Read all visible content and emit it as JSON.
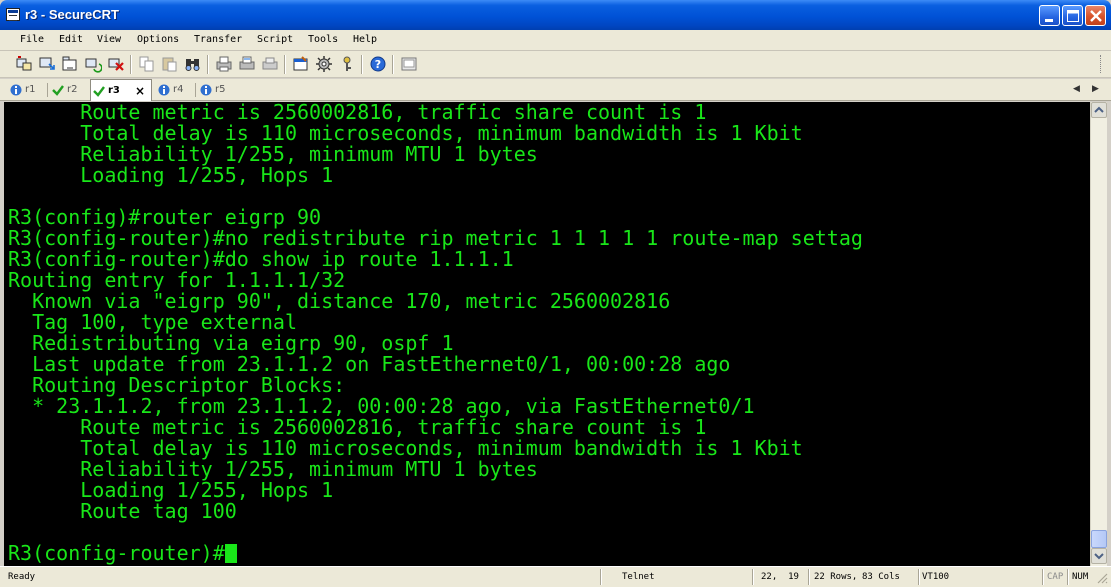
{
  "window": {
    "title": "r3 - SecureCRT",
    "icon": "securecrt-app-icon",
    "controls": [
      "minimize-icon",
      "maximize-icon",
      "close-icon"
    ]
  },
  "menu": [
    "File",
    "Edit",
    "View",
    "Options",
    "Transfer",
    "Script",
    "Tools",
    "Help"
  ],
  "toolbar": {
    "icons": [
      "connect-icon",
      "quick-connect-icon",
      "connect-in-tab-icon",
      "reconnect-icon",
      "disconnect-icon",
      "copy-icon",
      "paste-icon",
      "find-icon",
      "print-icon",
      "print-selection-icon",
      "print-screen-icon",
      "session-options-icon",
      "global-options-icon",
      "keymap-icon",
      "help-icon",
      "sftp-icon"
    ]
  },
  "tabs": [
    {
      "label": "r1",
      "icon": "info-icon",
      "active": false
    },
    {
      "label": "r2",
      "icon": "checkmark-icon",
      "active": false
    },
    {
      "label": "r3",
      "icon": "checkmark-icon",
      "active": true
    },
    {
      "label": "r4",
      "icon": "info-icon",
      "active": false
    },
    {
      "label": "r5",
      "icon": "info-icon",
      "active": false
    }
  ],
  "tab_close_glyph": "×",
  "tab_nav": {
    "left": "◀",
    "right": "▶"
  },
  "terminal": {
    "text_color": "#19e619",
    "background": "#000000",
    "lines": [
      "      Route metric is 2560002816, traffic share count is 1",
      "      Total delay is 110 microseconds, minimum bandwidth is 1 Kbit",
      "      Reliability 1/255, minimum MTU 1 bytes",
      "      Loading 1/255, Hops 1",
      "",
      "R3(config)#router eigrp 90",
      "R3(config-router)#no redistribute rip metric 1 1 1 1 1 route-map settag",
      "R3(config-router)#do show ip route 1.1.1.1",
      "Routing entry for 1.1.1.1/32",
      "  Known via \"eigrp 90\", distance 170, metric 2560002816",
      "  Tag 100, type external",
      "  Redistributing via eigrp 90, ospf 1",
      "  Last update from 23.1.1.2 on FastEthernet0/1, 00:00:28 ago",
      "  Routing Descriptor Blocks:",
      "  * 23.1.1.2, from 23.1.1.2, 00:00:28 ago, via FastEthernet0/1",
      "      Route metric is 2560002816, traffic share count is 1",
      "      Total delay is 110 microseconds, minimum bandwidth is 1 Kbit",
      "      Reliability 1/255, minimum MTU 1 bytes",
      "      Loading 1/255, Hops 1",
      "      Route tag 100",
      "",
      "R3(config-router)#"
    ]
  },
  "statusbar": {
    "status": "Ready",
    "protocol": "Telnet",
    "cursor_pos": "22,  19",
    "rows": "22 Rows,",
    "cols": "83 Cols",
    "terminal_type": "VT100",
    "caps": "CAP",
    "num": "NUM"
  }
}
